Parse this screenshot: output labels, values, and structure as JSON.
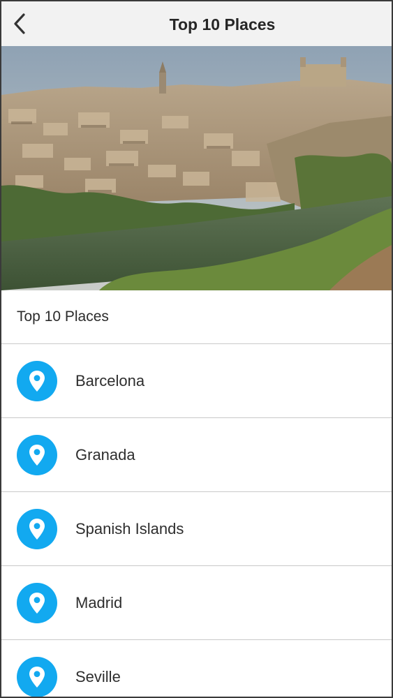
{
  "header": {
    "back_icon": "chevron-left-icon",
    "title": "Top 10 Places"
  },
  "hero": {
    "description_icon": "city-photo"
  },
  "section": {
    "title": "Top 10 Places"
  },
  "places": [
    {
      "label": "Barcelona",
      "icon": "map-pin-icon"
    },
    {
      "label": "Granada",
      "icon": "map-pin-icon"
    },
    {
      "label": "Spanish Islands",
      "icon": "map-pin-icon"
    },
    {
      "label": "Madrid",
      "icon": "map-pin-icon"
    },
    {
      "label": "Seville",
      "icon": "map-pin-icon"
    }
  ],
  "colors": {
    "accent": "#12a9f0",
    "nav_background": "#f2f2f2",
    "divider": "#c9c9c9"
  }
}
